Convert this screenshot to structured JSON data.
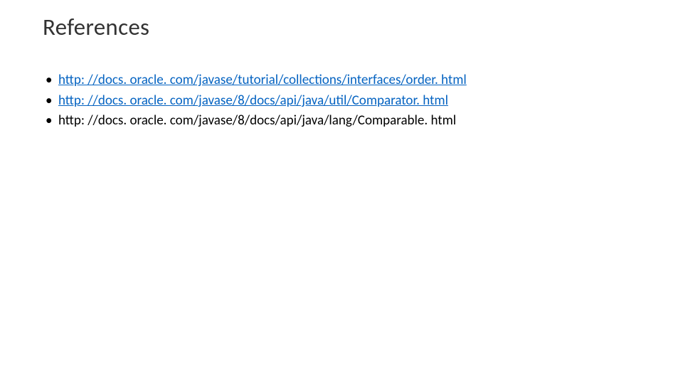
{
  "title": "References",
  "items": [
    {
      "text": "http: //docs. oracle. com/javase/tutorial/collections/interfaces/order. html",
      "link": true
    },
    {
      "text": "http: //docs. oracle. com/javase/8/docs/api/java/util/Comparator. html",
      "link": true
    },
    {
      "text": "http: //docs. oracle. com/javase/8/docs/api/java/lang/Comparable. html",
      "link": false
    }
  ]
}
